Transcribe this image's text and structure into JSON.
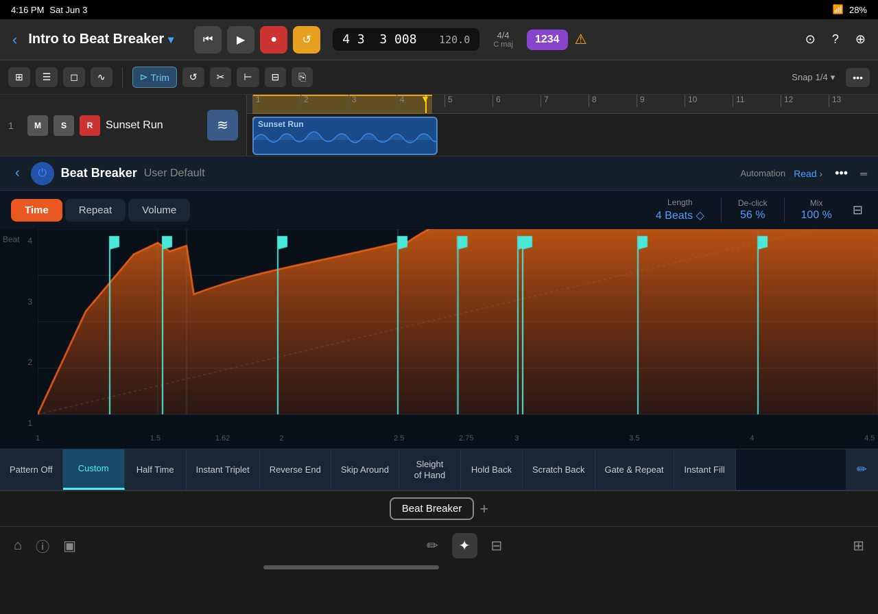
{
  "statusBar": {
    "time": "4:16 PM",
    "day": "Sat Jun 3",
    "battery": "28%",
    "wifi": true
  },
  "header": {
    "backLabel": "‹",
    "title": "Intro to Beat Breaker",
    "dropdownIcon": "▾",
    "skipBackLabel": "⏮",
    "playLabel": "▶",
    "recordLabel": "●",
    "loopLabel": "↺",
    "position": "4 3  3 008",
    "bpm": "120.0",
    "timeSignature": "4/4",
    "key": "C maj",
    "keyDisplay": "1234",
    "warningIcon": "⚠",
    "airplayIcon": "⊡",
    "helpIcon": "?",
    "moreIcon": "⊕"
  },
  "secondaryToolbar": {
    "gridIcon": "⊞",
    "listIcon": "☰",
    "windowIcon": "◻",
    "curveIcon": "∿",
    "trimLabel": "Trim",
    "trimIcon": "⊳",
    "loopIcon": "↺",
    "scissorsIcon": "✂",
    "splitIcon": "⊢",
    "multiIcon": "⊟",
    "copyIcon": "⎘",
    "snapLabel": "Snap",
    "snapValue": "1/4",
    "snapChevron": "▾",
    "moreIcon": "•••"
  },
  "track": {
    "number": "1",
    "muteLabel": "M",
    "soloLabel": "S",
    "recLabel": "R",
    "name": "Sunset Run",
    "clipName": "Sunset Run"
  },
  "ruler": {
    "marks": [
      "1",
      "2",
      "3",
      "4",
      "5",
      "6",
      "7",
      "8",
      "9",
      "10",
      "11",
      "12",
      "13"
    ]
  },
  "plugin": {
    "backLabel": "‹",
    "powerLabel": "⏻",
    "name": "Beat Breaker",
    "preset": "User Default",
    "automationLabel": "Automation",
    "automationValue": "Read",
    "automationChevron": "›",
    "moreIcon": "•••",
    "linesIcon": "═"
  },
  "tabs": {
    "timeLabel": "Time",
    "repeatLabel": "Repeat",
    "volumeLabel": "Volume"
  },
  "controls": {
    "lengthLabel": "Length",
    "lengthValue": "4 Beats",
    "lengthChevron": "◇",
    "declickLabel": "De-click",
    "declickValue": "56 %",
    "mixLabel": "Mix",
    "mixValue": "100 %",
    "mixIcon": "⊟"
  },
  "graph": {
    "beatLabel": "Beat",
    "yAxis": [
      "4",
      "3",
      "2",
      "1"
    ],
    "xAxis": [
      "1",
      "1.5",
      "1.62",
      "2",
      "2.5",
      "2.75",
      "3",
      "3.5",
      "4",
      "4.5"
    ],
    "flags": [
      {
        "x": 17,
        "label": "flag1"
      },
      {
        "x": 21,
        "label": "flag2"
      },
      {
        "x": 38,
        "label": "flag3"
      },
      {
        "x": 46,
        "label": "flag4"
      },
      {
        "x": 52,
        "label": "flag5"
      },
      {
        "x": 61,
        "label": "flag6"
      },
      {
        "x": 63,
        "label": "flag7"
      },
      {
        "x": 73,
        "label": "flag8"
      },
      {
        "x": 83,
        "label": "flag9"
      }
    ]
  },
  "patterns": [
    {
      "id": "pattern-off",
      "label": "Pattern Off",
      "active": false
    },
    {
      "id": "custom",
      "label": "Custom",
      "active": true
    },
    {
      "id": "half-time",
      "label": "Half Time",
      "active": false
    },
    {
      "id": "instant-triplet",
      "label": "Instant Triplet",
      "active": false
    },
    {
      "id": "reverse-end",
      "label": "Reverse End",
      "active": false
    },
    {
      "id": "skip-around",
      "label": "Skip Around",
      "active": false
    },
    {
      "id": "sleight-of-hand",
      "label": "Sleight of Hand",
      "active": false
    },
    {
      "id": "hold-back",
      "label": "Hold Back",
      "active": false
    },
    {
      "id": "scratch-back",
      "label": "Scratch Back",
      "active": false
    },
    {
      "id": "gate-repeat",
      "label": "Gate & Repeat",
      "active": false
    },
    {
      "id": "instant-fill",
      "label": "Instant Fill",
      "active": false
    }
  ],
  "bottomTabBar": {
    "beatBreakerLabel": "Beat Breaker",
    "addLabel": "+"
  },
  "bottomBar": {
    "homeIcon": "⌂",
    "infoIcon": "ⓘ",
    "libraryIcon": "▣",
    "penIcon": "✏",
    "glowIcon": "✦",
    "mixerIcon": "⊟",
    "metroIcon": "⊞"
  }
}
